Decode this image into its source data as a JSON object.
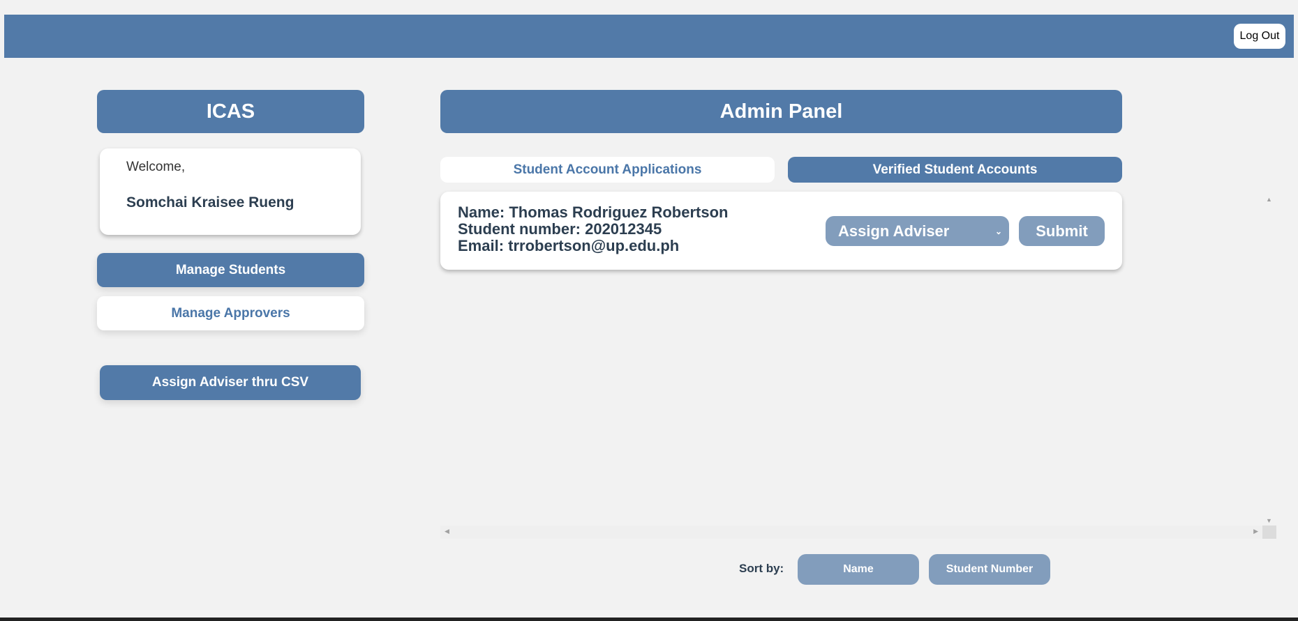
{
  "header": {
    "logout_label": "Log Out"
  },
  "sidebar": {
    "app_title": "ICAS",
    "welcome_label": "Welcome,",
    "user_name": "Somchai Kraisee Rueng",
    "nav": [
      {
        "label": "Manage Students",
        "active": true
      },
      {
        "label": "Manage Approvers",
        "active": false
      }
    ],
    "csv_button_label": "Assign Adviser thru CSV"
  },
  "main": {
    "title": "Admin Panel",
    "tabs": [
      {
        "label": "Student Account Applications",
        "active": false
      },
      {
        "label": "Verified Student Accounts",
        "active": true
      }
    ],
    "students": [
      {
        "name": "Name: Thomas Rodriguez Robertson",
        "student_number": "Student number: 202012345",
        "email": "Email: trrobertson@up.edu.ph",
        "adviser_select": "Assign Adviser",
        "submit_label": "Submit"
      }
    ],
    "sort": {
      "label": "Sort by:",
      "options": [
        "Name",
        "Student Number"
      ]
    }
  },
  "colors": {
    "primary": "#527aa8",
    "secondary": "#829dbc",
    "text": "#2c3e50",
    "background": "#f2f2f2"
  }
}
